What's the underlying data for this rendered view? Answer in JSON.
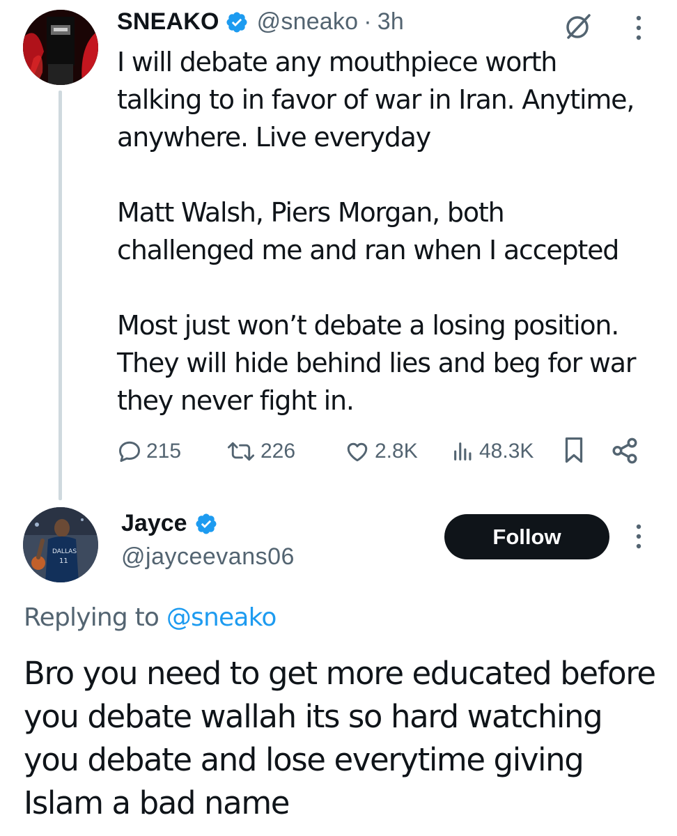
{
  "parent_tweet": {
    "author_name": "SNEAKO",
    "author_handle": "@sneako",
    "separator": "·",
    "time": "3h",
    "text": "I will debate any mouthpiece worth\ntalking to in favor of war in Iran. Anytime,\nanywhere. Live everyday\n\nMatt Walsh, Piers Morgan, both\nchallenged me and ran when I accepted\n\nMost just won’t debate a losing position.\nThey will hide behind lies and beg for war\nthey never fight in.",
    "actions": {
      "replies": "215",
      "reposts": "226",
      "likes": "2.8K",
      "views": "48.3K"
    }
  },
  "reply_tweet": {
    "author_name": "Jayce",
    "author_handle": "@jayceevans06",
    "follow_label": "Follow",
    "replying_prefix": "Replying to",
    "replying_to": "@sneako",
    "text": "Bro you need to get more educated before you debate wallah its so hard watching you debate and lose everytime giving Islam a bad name"
  },
  "colors": {
    "text": "#0f1419",
    "secondary": "#536471",
    "accent": "#1d9bf0",
    "thread_line": "#cfd9de",
    "follow_bg": "#0f1419"
  },
  "icons": [
    "verified-badge-icon",
    "grok-icon",
    "more-options-icon",
    "reply-icon",
    "repost-icon",
    "like-icon",
    "views-icon",
    "bookmark-icon",
    "share-icon"
  ]
}
